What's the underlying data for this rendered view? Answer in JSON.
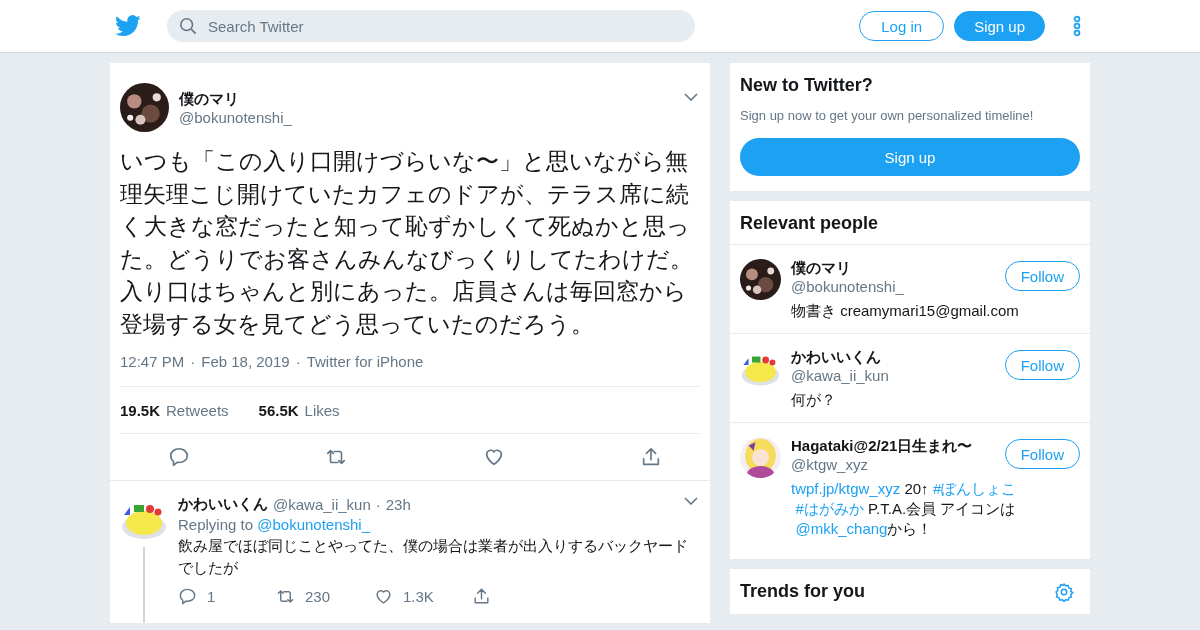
{
  "header": {
    "search": {
      "placeholder": "Search Twitter"
    },
    "buttons": [
      {
        "label": "Log in",
        "kind": "outline"
      },
      {
        "label": "Sign up",
        "kind": "filled"
      }
    ]
  },
  "tweet": {
    "name": "僕のマリ",
    "handle": "@bokunotenshi_",
    "text": "いつも「この入り口開けづらいな〜」と思いながら無理矢理こじ開けていたカフェのドアが、テラス席に続く大きな窓だったと知って恥ずかしくて死ぬかと思った。どうりでお客さんみんなびっくりしてたわけだ。入り口はちゃんと別にあった。店員さんは毎回窓から登場する女を見てどう思っていたのだろう。",
    "meta": [
      "12:47 PM",
      "Feb 18, 2019",
      "Twitter for iPhone"
    ],
    "meta_separator": "·",
    "stats": [
      {
        "count": "19.5K",
        "label": "Retweets"
      },
      {
        "count": "56.5K",
        "label": "Likes"
      }
    ],
    "actions": [
      {
        "kind": "reply"
      },
      {
        "kind": "retweet"
      },
      {
        "kind": "like"
      },
      {
        "kind": "share"
      }
    ]
  },
  "reply": {
    "name": "かわいいくん",
    "handle": "@kawa_ii_kun",
    "time": "23h",
    "separator": "·",
    "replying_label": "Replying to",
    "replying_to": "@bokunotenshi_",
    "text": "飲み屋でほぼ同じことやってた、僕の場合は業者が出入りするバックヤードでしたが",
    "actions": [
      {
        "kind": "reply",
        "count": "1"
      },
      {
        "kind": "retweet",
        "count": "230"
      },
      {
        "kind": "like",
        "count": "1.3K"
      },
      {
        "kind": "share"
      }
    ]
  },
  "signup_card": {
    "title": "New to Twitter?",
    "subtitle": "Sign up now to get your own personalized timeline!",
    "button": "Sign up"
  },
  "relevant_people": {
    "title": "Relevant people",
    "people": [
      {
        "name": "僕のマリ",
        "handle": "@bokunotenshi_",
        "follow": "Follow",
        "bio": [
          {
            "kind": "text",
            "text": "物書き creamymari15@gmail.com"
          }
        ]
      },
      {
        "name": "かわいいくん",
        "handle": "@kawa_ii_kun",
        "follow": "Follow",
        "bio": [
          {
            "kind": "text",
            "text": "何が？"
          }
        ]
      },
      {
        "name": "Hagataki@2/21日生まれ〜",
        "handle": "@ktgw_xyz",
        "follow": "Follow",
        "bio": [
          {
            "kind": "link",
            "text": "twpf.jp/ktgw_xyz"
          },
          {
            "kind": "text",
            "text": " 20↑"
          },
          {
            "kind": "link",
            "text": "#ぽんしょこ"
          },
          {
            "kind": "link",
            "text": "#はがみか"
          },
          {
            "kind": "text",
            "text": " P.T.A.会員 アイコンは"
          },
          {
            "kind": "link",
            "text": "@mkk_chang"
          },
          {
            "kind": "text",
            "text": "から！"
          }
        ]
      }
    ]
  },
  "trends": {
    "title": "Trends for you"
  }
}
